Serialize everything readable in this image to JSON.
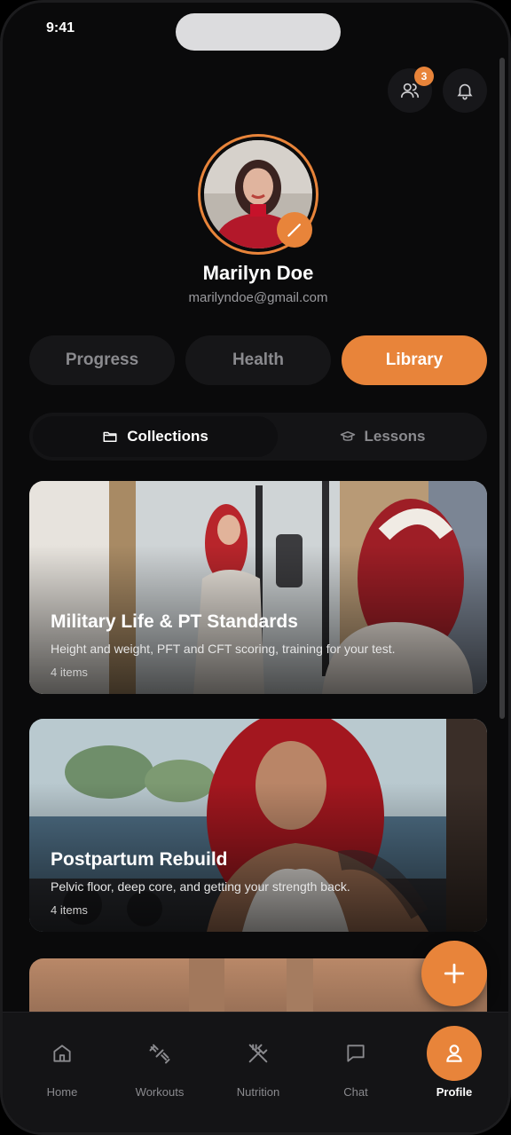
{
  "status_bar": {
    "time": "9:41"
  },
  "header": {
    "friends_badge": "3"
  },
  "profile": {
    "name": "Marilyn Doe",
    "email": "marilyndoe@gmail.com"
  },
  "segments": [
    {
      "label": "Progress",
      "active": false
    },
    {
      "label": "Health",
      "active": false
    },
    {
      "label": "Library",
      "active": true
    }
  ],
  "subtabs": [
    {
      "label": "Collections",
      "icon": "folder-icon",
      "active": true
    },
    {
      "label": "Lessons",
      "icon": "graduation-cap-icon",
      "active": false
    }
  ],
  "collections": [
    {
      "title": "Military Life & PT Standards",
      "description": "Height and weight, PFT and CFT scoring, training for your test.",
      "count": "4 items"
    },
    {
      "title": "Postpartum Rebuild",
      "description": "Pelvic floor, deep core, and getting your strength back.",
      "count": "4 items"
    }
  ],
  "tabbar": [
    {
      "label": "Home",
      "icon": "home-icon"
    },
    {
      "label": "Workouts",
      "icon": "dumbbell-icon"
    },
    {
      "label": "Nutrition",
      "icon": "utensils-icon"
    },
    {
      "label": "Chat",
      "icon": "chat-icon"
    },
    {
      "label": "Profile",
      "icon": "user-icon",
      "active": true
    }
  ],
  "colors": {
    "accent": "#e8843a",
    "background": "#0a0a0b",
    "surface": "#161618"
  }
}
